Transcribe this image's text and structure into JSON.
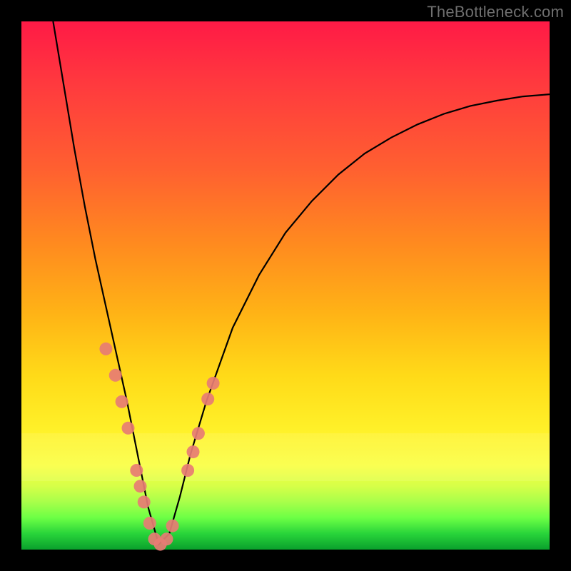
{
  "watermark": "TheBottleneck.com",
  "chart_data": {
    "type": "line",
    "title": "",
    "subtitle": "",
    "xlabel": "",
    "ylabel": "",
    "xlim": [
      0,
      100
    ],
    "ylim": [
      0,
      100
    ],
    "grid": false,
    "legend": false,
    "axes_visible": false,
    "description": "V-shaped bottleneck curve over a red-to-green vertical gradient background. Curve minimum near x≈26, y≈0. Salmon dots mark points along the lower flanks of the V.",
    "series": [
      {
        "name": "bottleneck-curve",
        "type": "line",
        "x": [
          6,
          8,
          10,
          12,
          14,
          16,
          18,
          20,
          22,
          24,
          26,
          28,
          30,
          32,
          35,
          40,
          45,
          50,
          55,
          60,
          65,
          70,
          75,
          80,
          85,
          90,
          95,
          100
        ],
        "y": [
          100,
          88,
          76,
          65,
          55,
          46,
          37,
          28,
          18,
          8,
          1,
          3,
          10,
          18,
          28,
          42,
          52,
          60,
          66,
          71,
          75,
          78,
          80.5,
          82.5,
          84,
          85,
          85.8,
          86.2
        ]
      },
      {
        "name": "marker-dots",
        "type": "scatter",
        "x": [
          16.0,
          17.8,
          19.0,
          20.2,
          21.8,
          22.5,
          23.2,
          24.3,
          25.2,
          26.3,
          27.5,
          28.6,
          31.5,
          32.5,
          33.5,
          35.3,
          36.3
        ],
        "y": [
          38.0,
          33.0,
          28.0,
          23.0,
          15.0,
          12.0,
          9.0,
          5.0,
          2.0,
          1.0,
          2.0,
          4.5,
          15.0,
          18.5,
          22.0,
          28.5,
          31.5
        ]
      }
    ],
    "colors": {
      "curve": "#000000",
      "dots": "#e77c74",
      "gradient_top": "#ff1a46",
      "gradient_bottom": "#0aa02c"
    }
  }
}
